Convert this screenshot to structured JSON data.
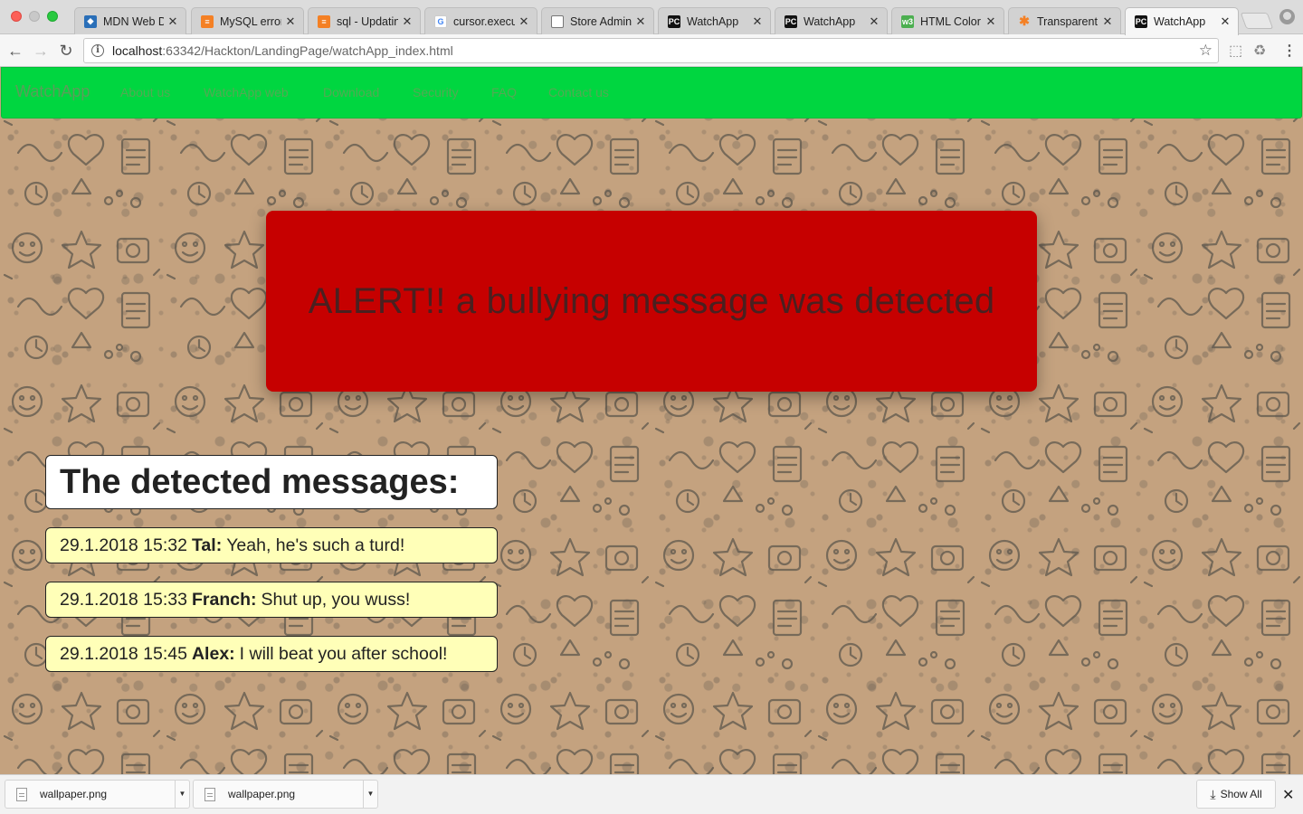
{
  "browser": {
    "tabs": [
      {
        "title": "MDN Web Do",
        "icon": "mdn-icon",
        "color": "#2a6fb8"
      },
      {
        "title": "MySQL error",
        "icon": "stackoverflow-icon",
        "color": "#f48024"
      },
      {
        "title": "sql - Updatin",
        "icon": "stackoverflow-icon",
        "color": "#f48024"
      },
      {
        "title": "cursor.execut",
        "icon": "google-icon",
        "color": "#4285f4"
      },
      {
        "title": "Store Admin",
        "icon": "page-icon",
        "color": "#ffffff"
      },
      {
        "title": "WatchApp",
        "icon": "pycharm-icon",
        "color": "#111111"
      },
      {
        "title": "WatchApp",
        "icon": "pycharm-icon",
        "color": "#111111"
      },
      {
        "title": "HTML Color P",
        "icon": "w3schools-icon",
        "color": "#4caf50"
      },
      {
        "title": "Transparent B",
        "icon": "asterisk-icon",
        "color": "#f48024"
      },
      {
        "title": "WatchApp",
        "icon": "pycharm-icon",
        "color": "#111111",
        "active": true
      }
    ],
    "url_host": "localhost",
    "url_rest": ":63342/Hackton/LandingPage/watchApp_index.html"
  },
  "navbar": {
    "brand": "WatchApp",
    "links": [
      "About us",
      "WatchApp web",
      "Download",
      "Security",
      "FAQ",
      "Contact us"
    ],
    "bg_color": "#00d640"
  },
  "alert": {
    "text": "ALERT!! a bullying message was detected",
    "bg_color": "#c60000"
  },
  "messages": {
    "heading": "The detected messages:",
    "items": [
      {
        "timestamp": "29.1.2018 15:32",
        "sender": "Tal:",
        "text": "Yeah, he's such a turd!"
      },
      {
        "timestamp": "29.1.2018 15:33",
        "sender": "Franch:",
        "text": "Shut up, you wuss!"
      },
      {
        "timestamp": "29.1.2018 15:45",
        "sender": "Alex:",
        "text": "I will beat you after school!"
      }
    ],
    "bg_color": "#ffffb8"
  },
  "downloads": {
    "items": [
      {
        "name": "wallpaper.png"
      },
      {
        "name": "wallpaper.png"
      }
    ],
    "show_all": "Show All"
  }
}
